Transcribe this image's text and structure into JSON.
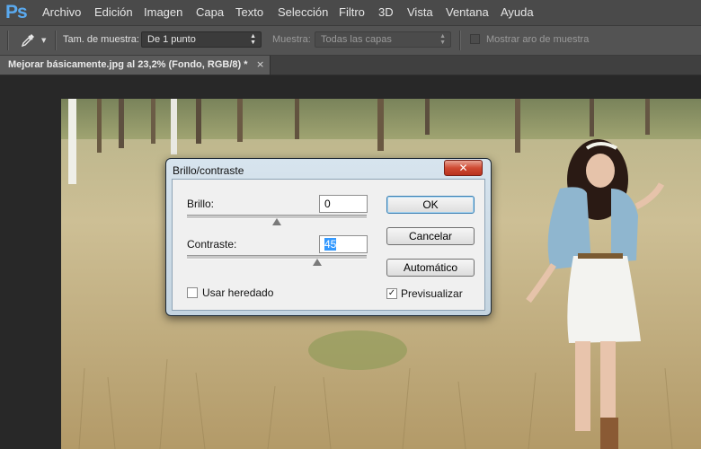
{
  "app": {
    "logo": "Ps"
  },
  "menu": [
    "Archivo",
    "Edición",
    "Imagen",
    "Capa",
    "Texto",
    "Selección",
    "Filtro",
    "3D",
    "Vista",
    "Ventana",
    "Ayuda"
  ],
  "options": {
    "tool_icon": "eyedropper-icon",
    "sample_size_label": "Tam. de muestra:",
    "sample_size_value": "De 1 punto",
    "sample_label": "Muestra:",
    "sample_value": "Todas las capas",
    "show_ring_label": "Mostrar aro de muestra"
  },
  "document_tab": {
    "title": "Mejorar básicamente.jpg al 23,2% (Fondo, RGB/8) *",
    "close_glyph": "×"
  },
  "dialog": {
    "title": "Brillo/contraste",
    "close_glyph": "✕",
    "brightness_label": "Brillo:",
    "brightness_value": "0",
    "brightness_level": 0.5,
    "contrast_label": "Contraste:",
    "contrast_value": "45",
    "contrast_level": 0.725,
    "legacy_label": "Usar heredado",
    "legacy_checked": false,
    "preview_label": "Previsualizar",
    "preview_checked": true,
    "ok_label": "OK",
    "cancel_label": "Cancelar",
    "auto_label": "Automático"
  },
  "colors": {
    "ps_blue": "#5aaaf0",
    "menubar": "#4a4a4a",
    "options_bar": "#535353",
    "workspace": "#282828",
    "dialog_close": "#cf4a33"
  }
}
